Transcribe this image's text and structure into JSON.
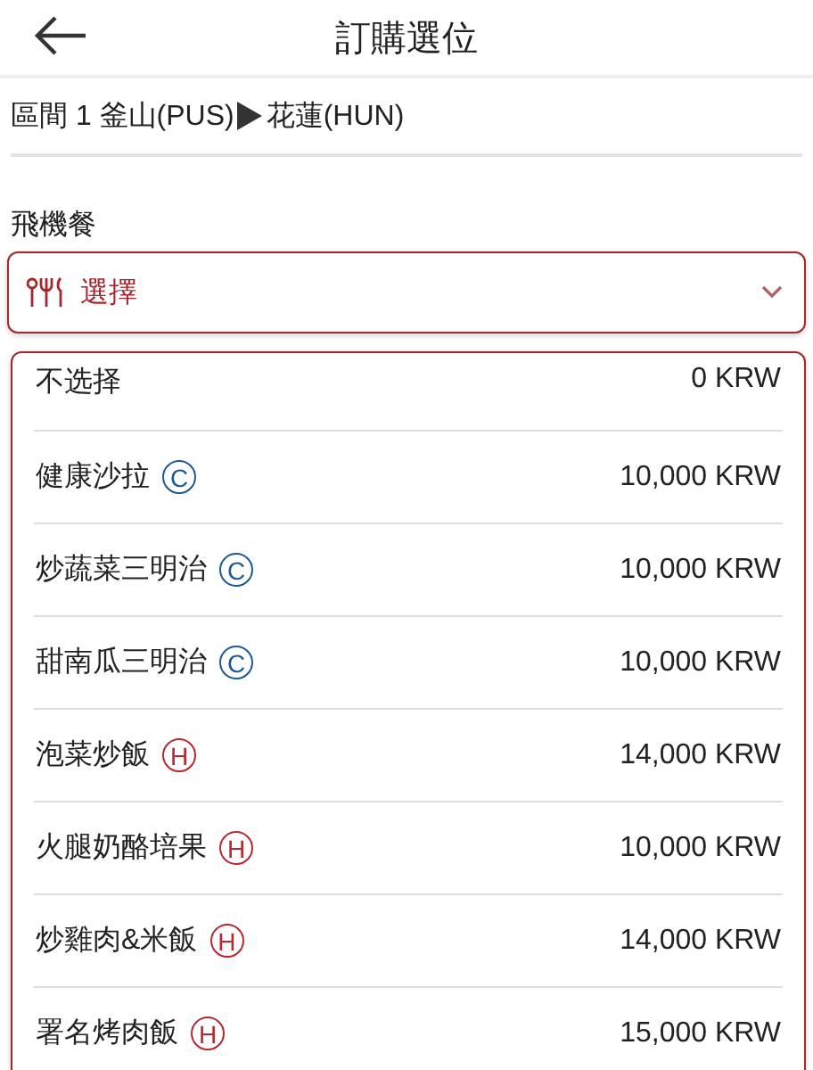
{
  "header": {
    "title": "訂購選位"
  },
  "route": {
    "from": "區間 1 釜山(PUS)",
    "to": "花蓮(HUN)"
  },
  "meal": {
    "label": "飛機餐",
    "value": "選擇"
  },
  "options": [
    {
      "name": "不选择",
      "price": "0 KRW"
    },
    {
      "name": "健康沙拉",
      "badge": {
        "text": "C",
        "color": "#1d5a92"
      },
      "price": "10,000 KRW"
    },
    {
      "name": "炒蔬菜三明治",
      "badge": {
        "text": "C",
        "color": "#1d5a92"
      },
      "price": "10,000 KRW"
    },
    {
      "name": "甜南瓜三明治",
      "badge": {
        "text": "C",
        "color": "#1d5a92"
      },
      "price": "10,000 KRW"
    },
    {
      "name": "泡菜炒飯",
      "badge": {
        "text": "H",
        "color": "#b8282e"
      },
      "price": "14,000 KRW"
    },
    {
      "name": "火腿奶酪培果",
      "badge": {
        "text": "H",
        "color": "#b8282e"
      },
      "price": "10,000 KRW"
    },
    {
      "name": "炒雞肉&米飯",
      "badge": {
        "text": "H",
        "color": "#b8282e"
      },
      "price": "14,000 KRW"
    },
    {
      "name": "署名烤肉飯",
      "badge": {
        "text": "H",
        "color": "#b8282e"
      },
      "price": "15,000 KRW"
    }
  ]
}
